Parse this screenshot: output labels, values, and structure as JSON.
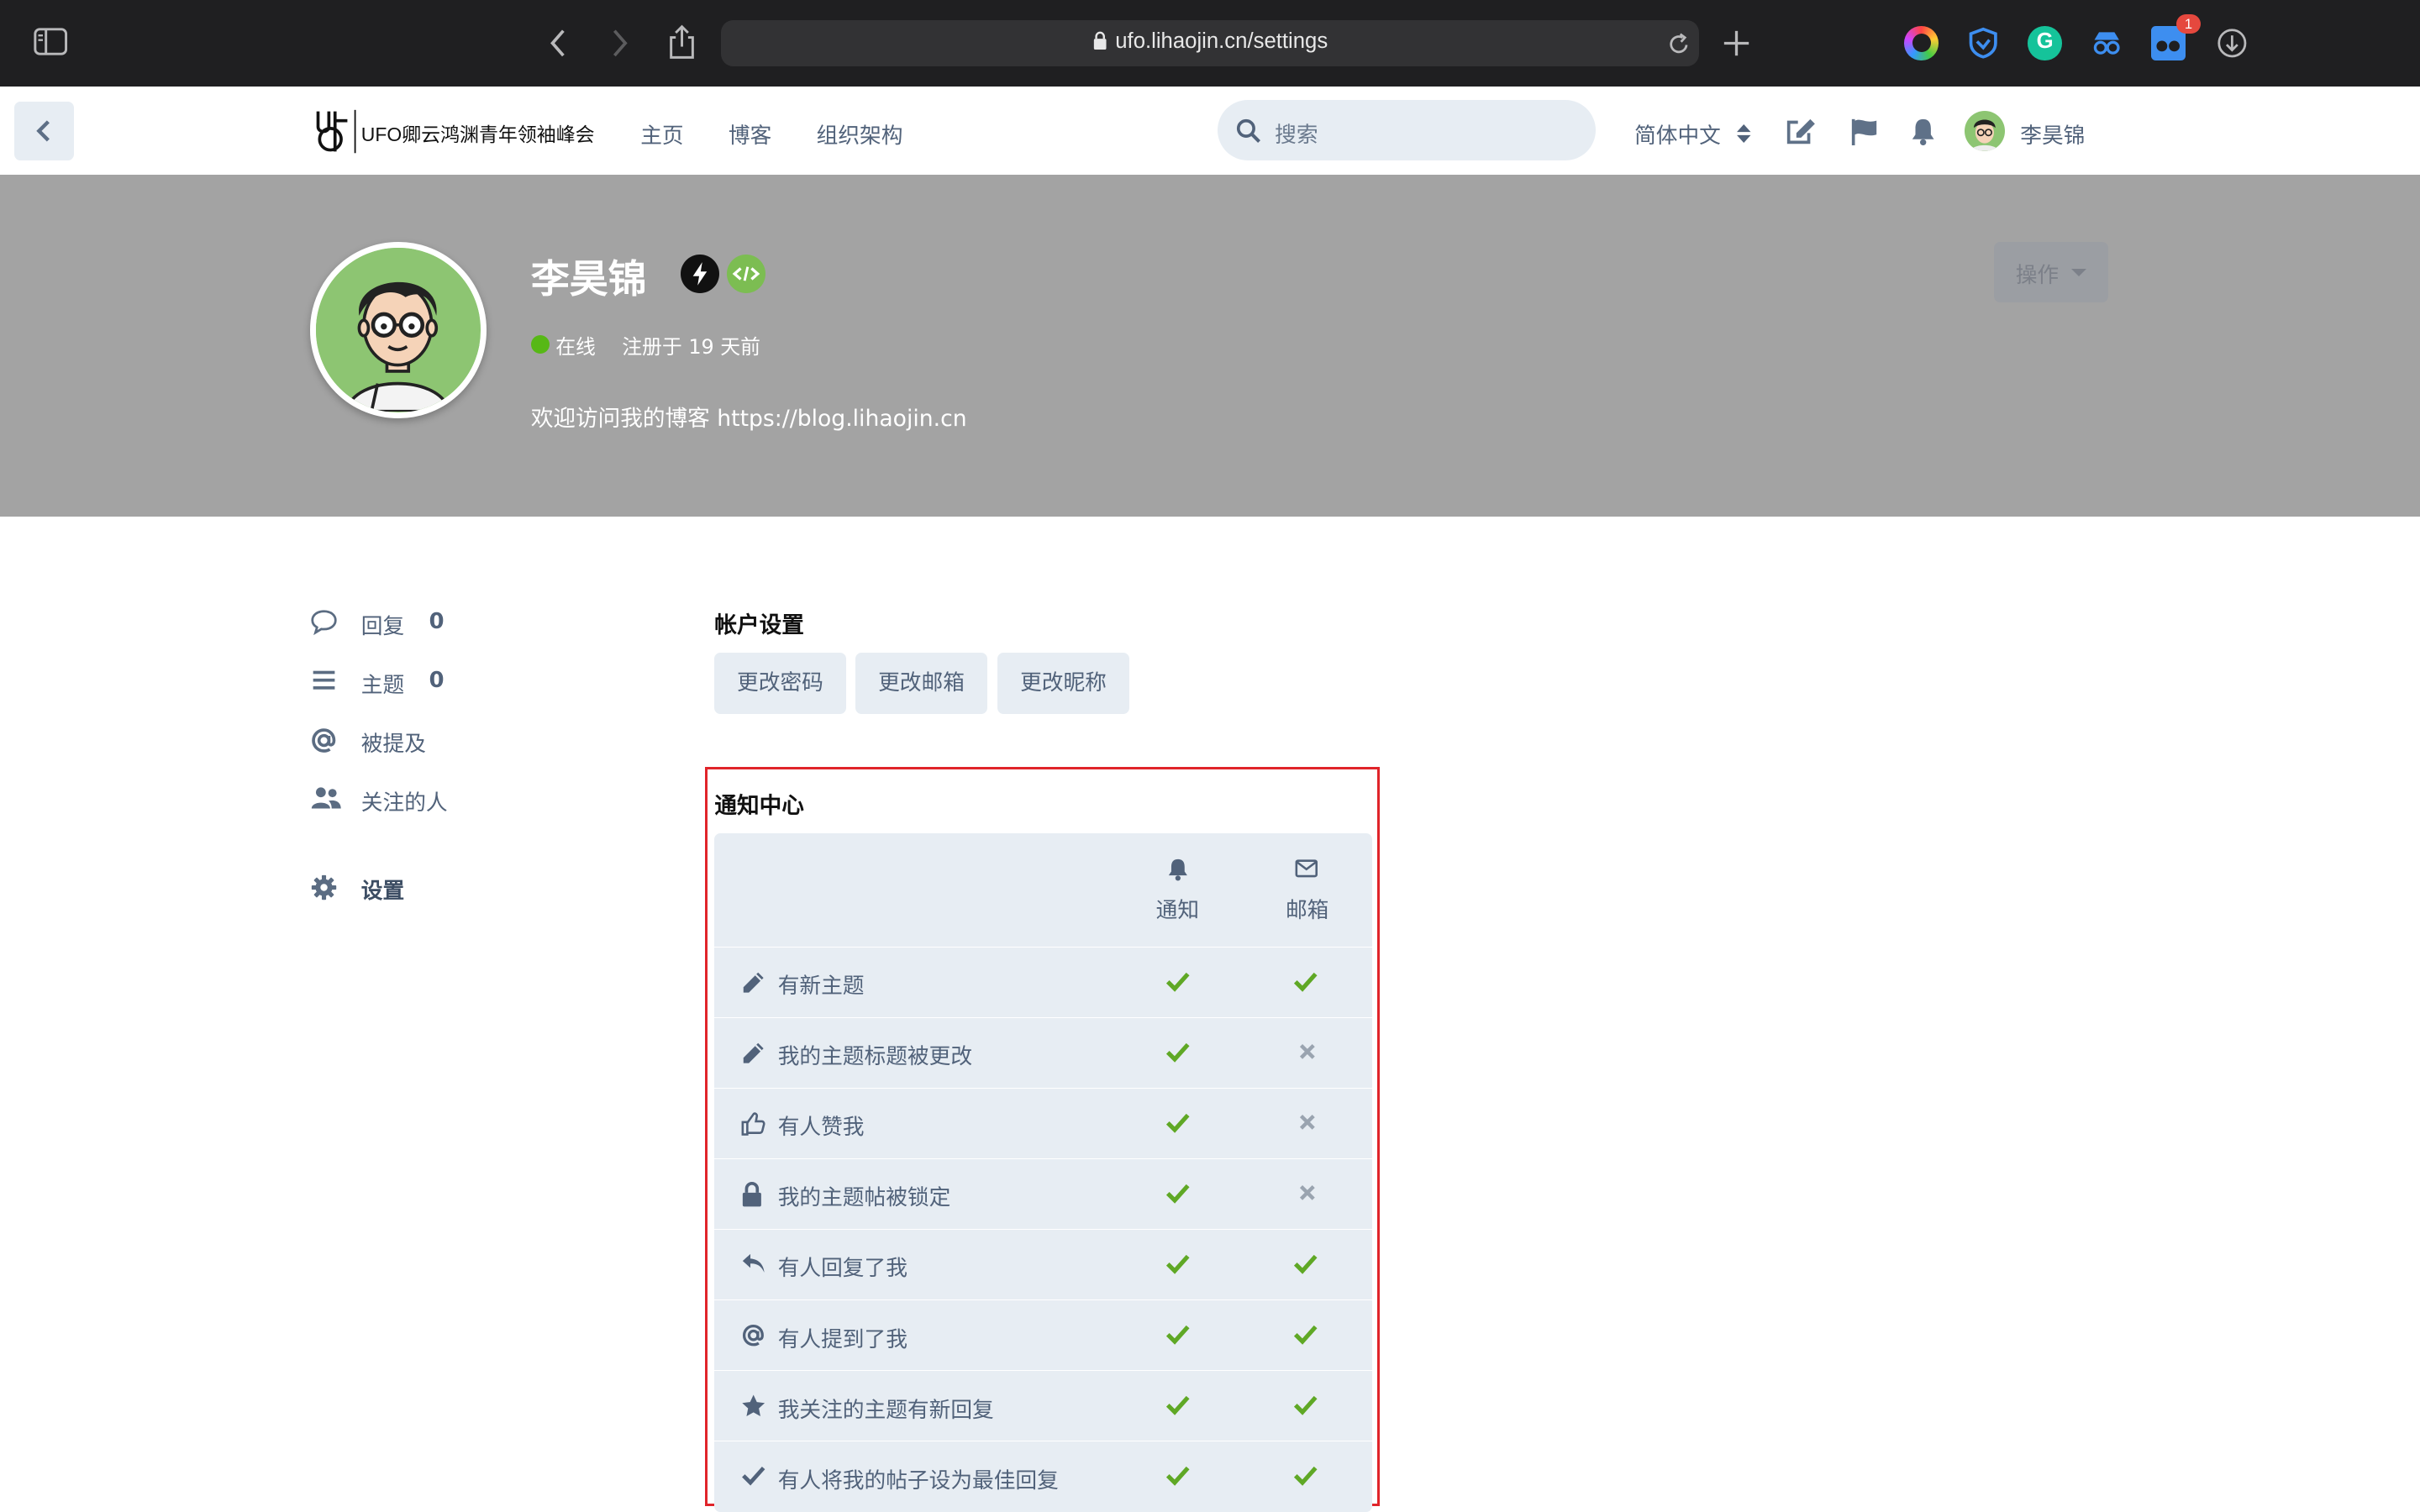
{
  "browser": {
    "url": "ufo.lihaojin.cn/settings",
    "extension_badge": "1"
  },
  "header": {
    "site_name": "UFO卿云鸿渊青年领袖峰会",
    "nav": [
      "主页",
      "博客",
      "组织架构"
    ],
    "search_placeholder": "搜索",
    "language": "简体中文",
    "username": "李昊锦"
  },
  "profile": {
    "name": "李昊锦",
    "status": "在线",
    "joined": "注册于 19 天前",
    "bio": "欢迎访问我的博客 https://blog.lihaojin.cn",
    "actions_label": "操作"
  },
  "sidebar": {
    "items": [
      {
        "label": "回复",
        "count": "0",
        "icon": "comment-icon"
      },
      {
        "label": "主题",
        "count": "0",
        "icon": "list-icon"
      },
      {
        "label": "被提及",
        "count": "",
        "icon": "at-icon"
      },
      {
        "label": "关注的人",
        "count": "",
        "icon": "users-icon"
      },
      {
        "label": "设置",
        "count": "",
        "icon": "gear-icon"
      }
    ]
  },
  "account": {
    "title": "帐户设置",
    "buttons": [
      "更改密码",
      "更改邮箱",
      "更改昵称"
    ]
  },
  "notifications": {
    "title": "通知中心",
    "columns": [
      "通知",
      "邮箱"
    ],
    "rows": [
      {
        "label": "有新主题",
        "icon": "pencil-icon",
        "notify": true,
        "email": true
      },
      {
        "label": "我的主题标题被更改",
        "icon": "pencil-icon",
        "notify": true,
        "email": false
      },
      {
        "label": "有人赞我",
        "icon": "thumbs-up-icon",
        "notify": true,
        "email": false
      },
      {
        "label": "我的主题帖被锁定",
        "icon": "lock-icon",
        "notify": true,
        "email": false
      },
      {
        "label": "有人回复了我",
        "icon": "reply-icon",
        "notify": true,
        "email": true
      },
      {
        "label": "有人提到了我",
        "icon": "at-icon",
        "notify": true,
        "email": true
      },
      {
        "label": "我关注的主题有新回复",
        "icon": "star-icon",
        "notify": true,
        "email": true
      },
      {
        "label": "有人将我的帖子设为最佳回复",
        "icon": "check-icon",
        "notify": true,
        "email": true
      }
    ]
  },
  "colors": {
    "hero_bg": "#a3a3a3",
    "accent_check": "#5fa825",
    "highlight_border": "#e0242a",
    "panel_bg": "#e7edf3"
  }
}
